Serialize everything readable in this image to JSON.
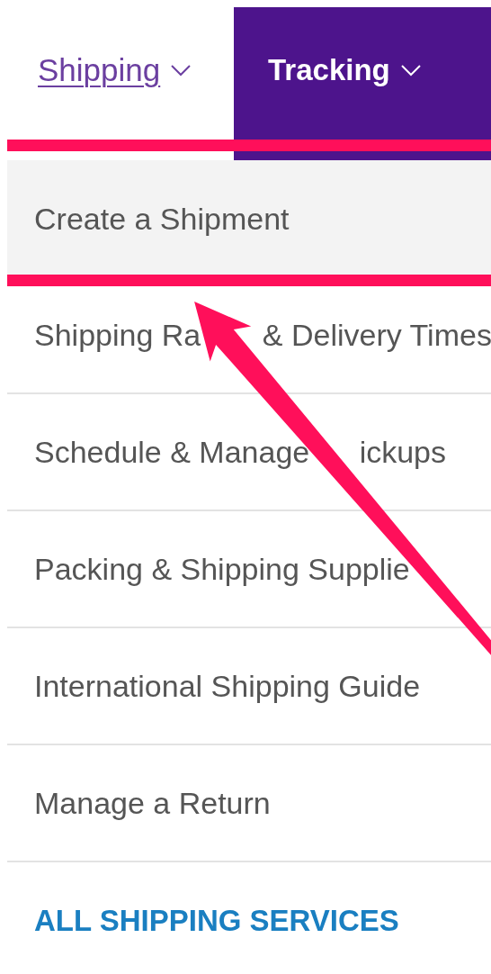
{
  "tabs": [
    {
      "label": "Shipping",
      "kind": "link",
      "expanded": true
    },
    {
      "label": "Tracking",
      "kind": "filled",
      "expanded": false
    }
  ],
  "menu": {
    "items": [
      {
        "parts": [
          "Create a Shipment"
        ],
        "hovered": true
      },
      {
        "parts": [
          "Shipping Ra",
          "& Delivery Times"
        ],
        "hovered": false
      },
      {
        "parts": [
          "Schedule & Manage",
          "ickups"
        ],
        "hovered": false
      },
      {
        "parts": [
          "Packing & Shipping Supplie"
        ],
        "hovered": false
      },
      {
        "parts": [
          "International Shipping Guide"
        ],
        "hovered": false
      },
      {
        "parts": [
          "Manage a Return"
        ],
        "hovered": false
      }
    ],
    "footer_link": "ALL SHIPPING SERVICES"
  },
  "annotation": {
    "kind": "highlight-with-arrow",
    "color": "#ff0f5a"
  }
}
